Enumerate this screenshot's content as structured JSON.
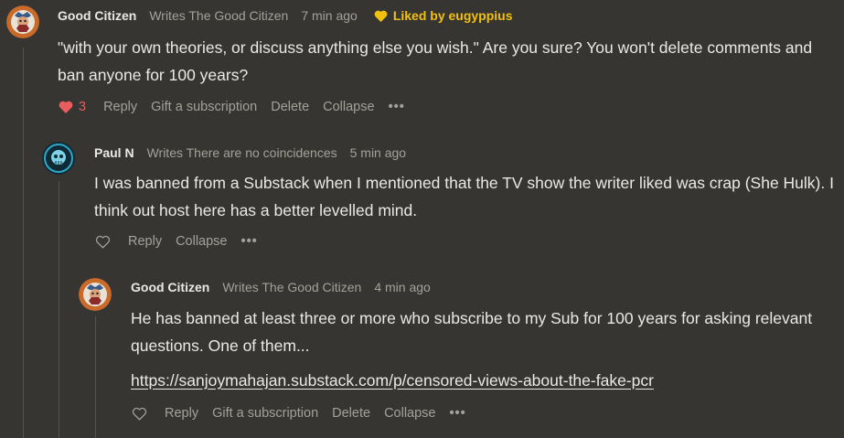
{
  "comments": [
    {
      "author": "Good Citizen",
      "subtitle": "Writes The Good Citizen",
      "time": "7 min ago",
      "liked_by": "Liked by eugyppius",
      "body": "\"with your own theories, or discuss anything else you wish.\" Are you sure? You won't delete comments and ban anyone for 100 years?",
      "like_count": "3",
      "actions": {
        "reply": "Reply",
        "gift": "Gift a subscription",
        "delete": "Delete",
        "collapse": "Collapse",
        "more": "•••"
      }
    },
    {
      "author": "Paul N",
      "subtitle": "Writes There are no coincidences",
      "time": "5 min ago",
      "body": "I was banned from a Substack when I mentioned that the TV show the writer liked was crap (She Hulk). I think out host here has a better levelled mind.",
      "actions": {
        "reply": "Reply",
        "collapse": "Collapse",
        "more": "•••"
      }
    },
    {
      "author": "Good Citizen",
      "subtitle": "Writes The Good Citizen",
      "time": "4 min ago",
      "body": "He has banned at least three or more who subscribe to my Sub for 100 years for asking relevant questions. One of them...",
      "link": "https://sanjoymahajan.substack.com/p/censored-views-about-the-fake-pcr",
      "actions": {
        "reply": "Reply",
        "gift": "Gift a subscription",
        "delete": "Delete",
        "collapse": "Collapse",
        "more": "•••"
      }
    }
  ],
  "colors": {
    "background": "#363531",
    "liked": "#f2c10f",
    "heart": "#e85d5d",
    "muted": "#a3a19c"
  }
}
